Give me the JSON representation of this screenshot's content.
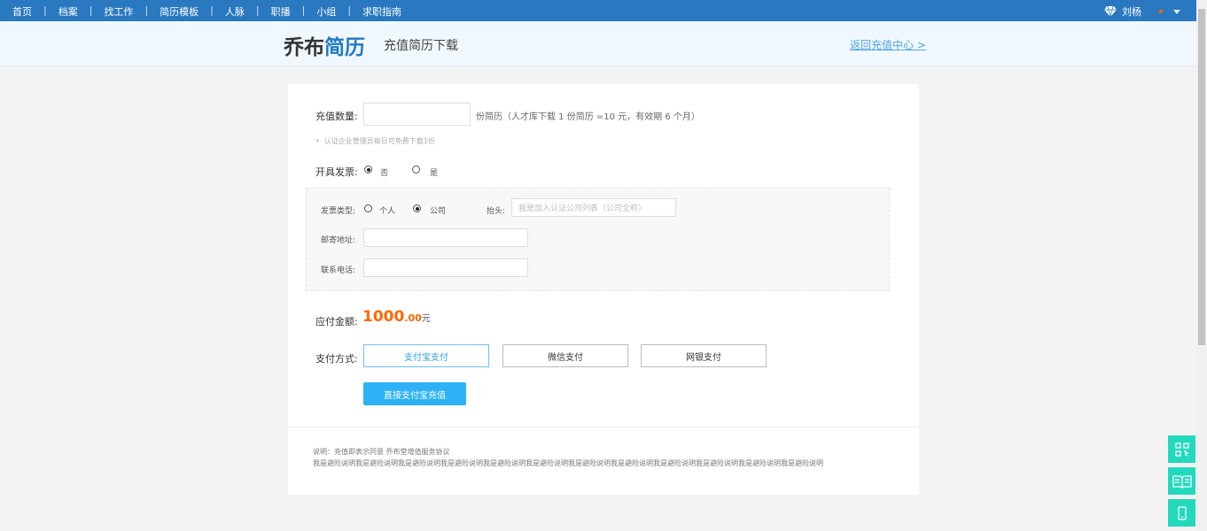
{
  "topbar": {
    "nav": [
      "首页",
      "档案",
      "找工作",
      "简历模板",
      "人脉",
      "职播",
      "小组",
      "求职指南"
    ],
    "separator": "|",
    "user_name": "刘杨"
  },
  "header": {
    "logo_black": "乔布",
    "logo_blue": "简历",
    "subtitle": "充值简历下载",
    "back_link": "返回充值中心 >"
  },
  "form": {
    "quantity_label": "充值数量:",
    "quantity_value": "",
    "quantity_hint": "份简历（人才库下载 1 份简历 =10 元，有效期 6 个月）",
    "free_tip": "认证企业管理员每日可免费下载1份",
    "invoice_label": "开具发票:",
    "invoice_options": [
      "否",
      "是"
    ],
    "invoice_selected": "否",
    "invoice_type_label": "发票类型:",
    "invoice_type_options": [
      "个人",
      "公司"
    ],
    "invoice_type_selected": "公司",
    "title_label": "抬头:",
    "title_placeholder": "我是加入认证公司列表（公司全称）",
    "address_label": "邮寄地址:",
    "phone_label": "联系电话:",
    "amount_label": "应付金额:",
    "amount_int": "1000",
    "amount_dec": ".00",
    "amount_unit": "元",
    "pay_label": "支付方式:",
    "pay_methods": [
      "支付宝支付",
      "微信支付",
      "网银支付"
    ],
    "pay_selected": "支付宝支付",
    "submit": "直接支付宝充值"
  },
  "notes": {
    "line1": "说明：充值即表示同意 乔布堂增值服务协议",
    "line2_phrase": "我是避险说明",
    "line2_repeat": 12
  },
  "colors": {
    "topbar": "#2a78bf",
    "accent": "#2eb2f5",
    "amount": "#ff6600",
    "side": "#22d9bd"
  },
  "side_icons": [
    "qr-code-icon",
    "book-icon",
    "phone-icon"
  ]
}
